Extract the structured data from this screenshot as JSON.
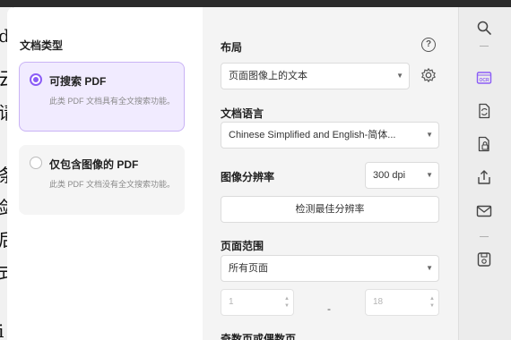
{
  "background_doc_chars": [
    "d",
    "云",
    "请",
    "条",
    "剑",
    "后",
    "式",
    "i"
  ],
  "left": {
    "title": "文档类型",
    "options": [
      {
        "label": "可搜索 PDF",
        "desc": "此类 PDF 文档具有全文搜索功能。",
        "selected": true
      },
      {
        "label": "仅包含图像的 PDF",
        "desc": "此类 PDF 文档没有全文搜索功能。",
        "selected": false
      }
    ]
  },
  "settings": {
    "layout_title": "布局",
    "layout_value": "页面图像上的文本",
    "language_title": "文档语言",
    "language_value": "Chinese Simplified and English-简体...",
    "resolution_title": "图像分辨率",
    "resolution_value": "300 dpi",
    "detect_button": "检测最佳分辨率",
    "range_title": "页面范围",
    "range_value": "所有页面",
    "range_from": "1",
    "range_to": "18",
    "range_separator": "-",
    "odd_even_title": "奇数页或偶数页"
  },
  "colors": {
    "accent": "#8b5cf6",
    "selected_bg": "#f1ebff"
  },
  "right_bar_icons": [
    "search-icon",
    "ocr-icon",
    "convert-icon",
    "protect-icon",
    "share-icon",
    "mail-icon",
    "save-icon"
  ]
}
